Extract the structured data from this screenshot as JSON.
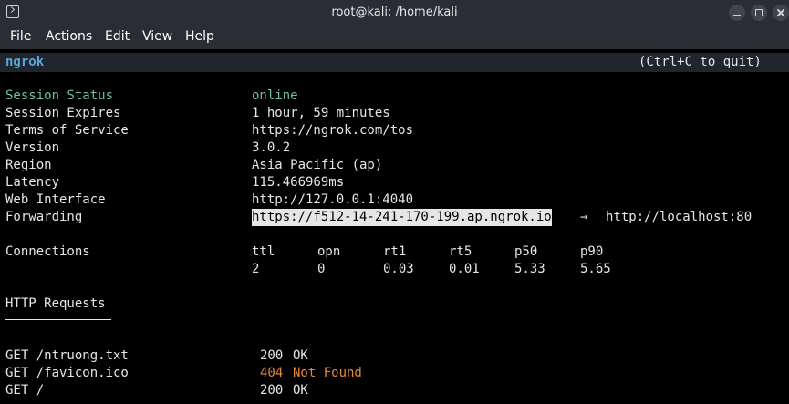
{
  "window": {
    "title": "root@kali: /home/kali"
  },
  "menu": [
    "File",
    "Actions",
    "Edit",
    "View",
    "Help"
  ],
  "header": {
    "brand": "ngrok",
    "hint": "(Ctrl+C to quit)"
  },
  "session": {
    "status_label": "Session Status",
    "status_value": "online",
    "expires_label": "Session Expires",
    "expires_value": "1 hour, 59 minutes",
    "tos_label": "Terms of Service",
    "tos_value": "https://ngrok.com/tos",
    "version_label": "Version",
    "version_value": "3.0.2",
    "region_label": "Region",
    "region_value": "Asia Pacific (ap)",
    "latency_label": "Latency",
    "latency_value": "115.466969ms",
    "web_label": "Web Interface",
    "web_value": "http://127.0.0.1:4040",
    "fwd_label": "Forwarding",
    "fwd_url": "https://f512-14-241-170-199.ap.ngrok.io",
    "fwd_arrow": "→",
    "fwd_target": "http://localhost:80"
  },
  "connections": {
    "label": "Connections",
    "headers": [
      "ttl",
      "opn",
      "rt1",
      "rt5",
      "p50",
      "p90"
    ],
    "values": [
      "2",
      "0",
      "0.03",
      "0.01",
      "5.33",
      "5.65"
    ]
  },
  "http": {
    "title": "HTTP Requests",
    "requests": [
      {
        "request": "GET /ntruong.txt",
        "code": "200",
        "status": "OK"
      },
      {
        "request": "GET /favicon.ico",
        "code": "404",
        "status": "Not Found"
      },
      {
        "request": "GET /",
        "code": "200",
        "status": "OK"
      }
    ]
  },
  "colors": {
    "accent": "#5aa6d8",
    "online": "#6fbfa0",
    "error": "#e5893a",
    "chrome": "#2a2d33"
  },
  "icons": [
    "terminal-icon",
    "minimize-icon",
    "maximize-icon",
    "close-icon"
  ]
}
